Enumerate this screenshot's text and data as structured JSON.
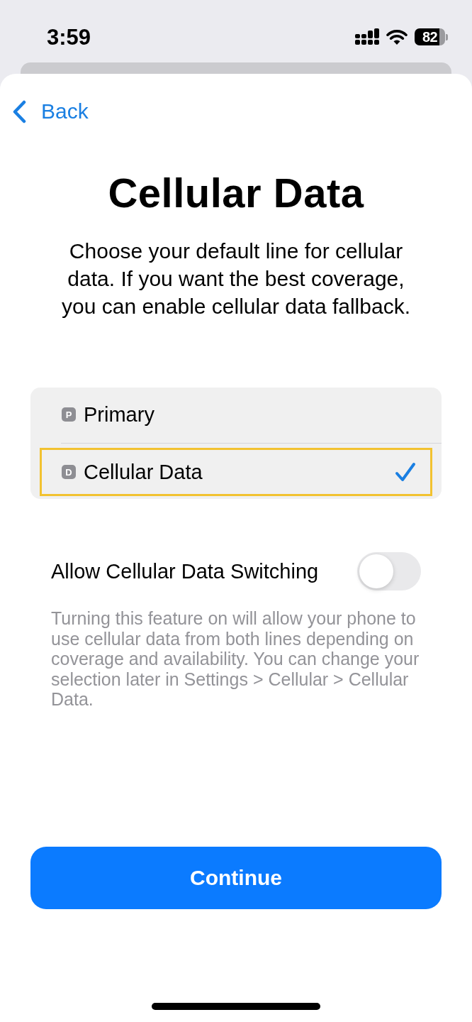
{
  "status_bar": {
    "time": "3:59",
    "battery": "82"
  },
  "nav": {
    "back": "Back"
  },
  "title": "Cellular Data",
  "description": "Choose your default line for cellular data. If you want the best coverage, you can enable cellular data fallback.",
  "lines": [
    {
      "badge": "P",
      "label": "Primary",
      "selected": false,
      "highlighted": false
    },
    {
      "badge": "D",
      "label": "Cellular Data",
      "selected": true,
      "highlighted": true
    }
  ],
  "switching": {
    "label": "Allow Cellular Data Switching",
    "on": false
  },
  "footnote": "Turning this feature on will allow your phone to use cellular data from both lines depending on coverage and availability. You can change your selection later in Settings > Cellular > Cellular Data.",
  "primary_button": "Continue"
}
